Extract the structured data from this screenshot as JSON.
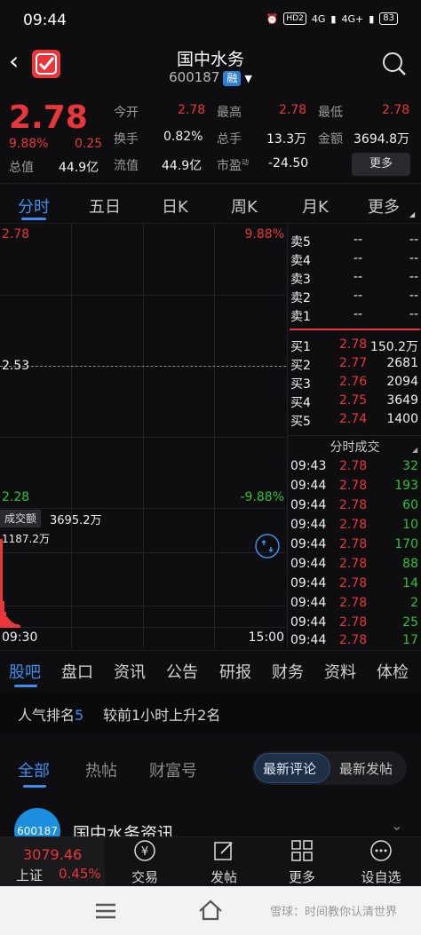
{
  "status_bar": {
    "time": "09:44",
    "sim1": "HD2",
    "sim2": "4G",
    "sim3": "4G+",
    "battery": "83"
  },
  "header": {
    "title": "国中水务",
    "code": "600187",
    "badge": "融"
  },
  "quote": {
    "price": "2.78",
    "pct": "9.88%",
    "change": "0.25",
    "zongzhi_label": "总值",
    "zongzhi": "44.9亿",
    "jinkai_label": "今开",
    "jinkai": "2.78",
    "huanshou_label": "换手",
    "huanshou": "0.82%",
    "liutong_label": "流值",
    "liutong": "44.9亿",
    "zuigao_label": "最高",
    "zuigao": "2.78",
    "zongshou_label": "总手",
    "zongshou": "13.3万",
    "shiying_label": "市盈",
    "shiying_sup": "动",
    "shiying": "-24.50",
    "zuidi_label": "最低",
    "zuidi": "2.78",
    "jine_label": "金额",
    "jine": "3694.8万",
    "more_button": "更多"
  },
  "chart_tabs": [
    "分时",
    "五日",
    "日K",
    "周K",
    "月K",
    "更多"
  ],
  "chart": {
    "price_high": "2.78",
    "pct_high": "9.88%",
    "price_mid": "2.53",
    "price_low": "2.28",
    "pct_low": "-9.88%",
    "volume_label": "成交额",
    "volume_value": "3695.2万",
    "volume_max": "1187.2万",
    "time_start": "09:30",
    "time_end": "15:00"
  },
  "order_book": {
    "asks": [
      {
        "label": "卖5",
        "price": "--",
        "vol": "--"
      },
      {
        "label": "卖4",
        "price": "--",
        "vol": "--"
      },
      {
        "label": "卖3",
        "price": "--",
        "vol": "--"
      },
      {
        "label": "卖2",
        "price": "--",
        "vol": "--"
      },
      {
        "label": "卖1",
        "price": "--",
        "vol": "--"
      }
    ],
    "bids": [
      {
        "label": "买1",
        "price": "2.78",
        "vol": "150.2万"
      },
      {
        "label": "买2",
        "price": "2.77",
        "vol": "2681"
      },
      {
        "label": "买3",
        "price": "2.76",
        "vol": "2094"
      },
      {
        "label": "买4",
        "price": "2.75",
        "vol": "3649"
      },
      {
        "label": "买5",
        "price": "2.74",
        "vol": "1400"
      }
    ],
    "trades_title": "分时成交",
    "trades": [
      {
        "time": "09:43",
        "price": "2.78",
        "vol": "32"
      },
      {
        "time": "09:44",
        "price": "2.78",
        "vol": "193"
      },
      {
        "time": "09:44",
        "price": "2.78",
        "vol": "60"
      },
      {
        "time": "09:44",
        "price": "2.78",
        "vol": "10"
      },
      {
        "time": "09:44",
        "price": "2.78",
        "vol": "170"
      },
      {
        "time": "09:44",
        "price": "2.78",
        "vol": "88"
      },
      {
        "time": "09:44",
        "price": "2.78",
        "vol": "14"
      },
      {
        "time": "09:44",
        "price": "2.78",
        "vol": "2"
      },
      {
        "time": "09:44",
        "price": "2.78",
        "vol": "25"
      },
      {
        "time": "09:44",
        "price": "2.78",
        "vol": "17"
      }
    ]
  },
  "guba_tabs": [
    "股吧",
    "盘口",
    "资讯",
    "公告",
    "研报",
    "财务",
    "资料",
    "体检"
  ],
  "popularity": {
    "prefix": "人气排名",
    "rank": "5",
    "trend": "较前1小时上升2名"
  },
  "feed_tabs": [
    "全部",
    "热帖",
    "财富号"
  ],
  "feed_sort": [
    "最新评论",
    "最新发帖"
  ],
  "post": {
    "avatar_text": "600187",
    "title": "国中水务资讯"
  },
  "bottom_nav": {
    "index_value": "3079.46",
    "index_name": "上证",
    "index_pct": "0.45%",
    "items": [
      "交易",
      "发帖",
      "更多",
      "设自选"
    ]
  },
  "watermark": "雪球：时间教你认清世界",
  "colors": {
    "up": "#e8363b",
    "down": "#2bc43a",
    "accent": "#3b8ef0"
  }
}
